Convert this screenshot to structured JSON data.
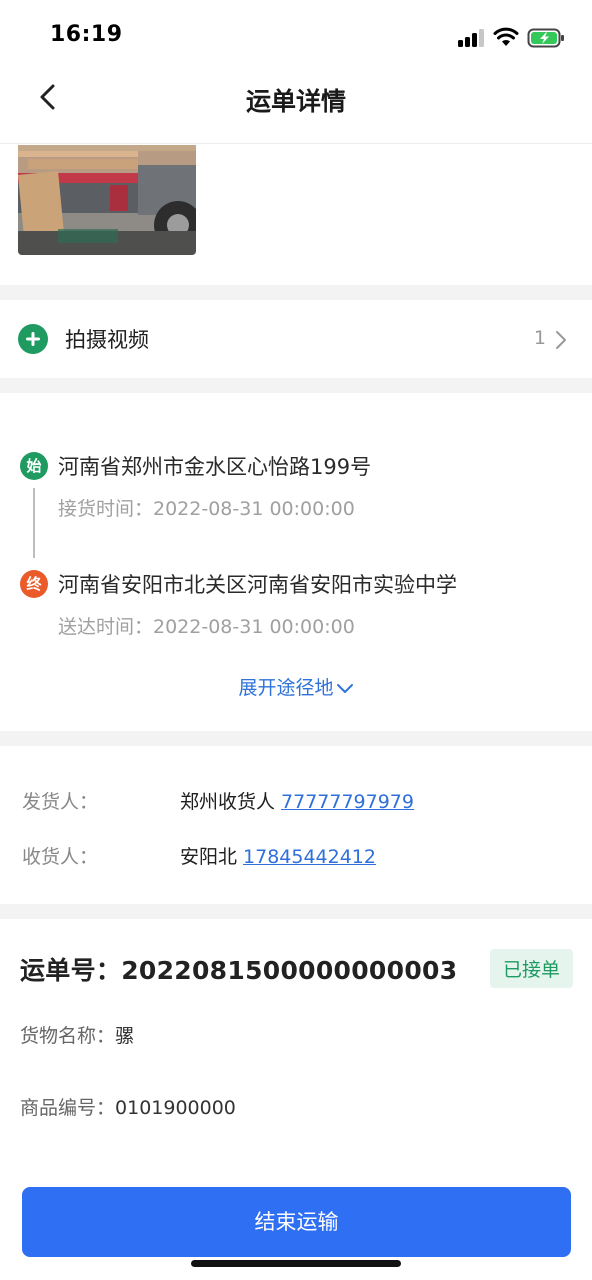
{
  "status_bar": {
    "time": "16:19"
  },
  "nav": {
    "title": "运单详情"
  },
  "video": {
    "label": "拍摄视频",
    "count": "1"
  },
  "route": {
    "start_badge": "始",
    "start_address": "河南省郑州市金水区心怡路199号",
    "pickup_time": "接货时间：2022-08-31 00:00:00",
    "end_badge": "终",
    "end_address": "河南省安阳市北关区河南省安阳市实验中学",
    "delivery_time": "送达时间：2022-08-31 00:00:00",
    "expand_label": "展开途径地"
  },
  "contacts": {
    "shipper_label": "发货人：",
    "shipper_name": "郑州收货人",
    "shipper_phone": "77777797979",
    "receiver_label": "收货人：",
    "receiver_name": "安阳北",
    "receiver_phone": "17845442412"
  },
  "order": {
    "number": "运单号：2022081500000000003",
    "status": "已接单",
    "goods_label": "货物名称：",
    "goods_value": "骡",
    "product_label": "商品编号：",
    "product_value": "0101900000"
  },
  "actions": {
    "end_button": "结束运输"
  },
  "colors": {
    "accent_blue": "#2f6ff3",
    "link_blue": "#2f73d9",
    "start_green": "#1f9a61",
    "end_orange": "#ea5a2a",
    "status_bg": "#e5f5ee"
  }
}
